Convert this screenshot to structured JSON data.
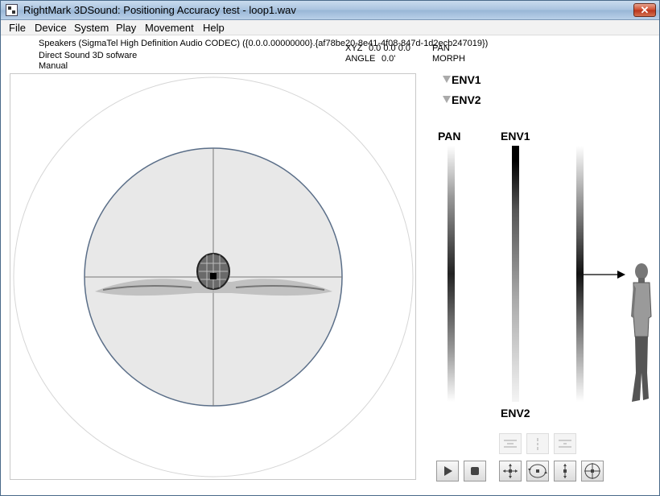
{
  "window": {
    "title": "RightMark 3DSound: Positioning Accuracy test - loop1.wav",
    "close_glyph": "✕"
  },
  "menu": [
    "File",
    "Device",
    "System",
    "Play",
    "Movement",
    "Help"
  ],
  "info": {
    "device": "Speakers (SigmaTel High Definition Audio CODEC) ({0.0.0.00000000}.{af78be20-8e41-4f08-847d-1d2ecb247019})",
    "engine": "Direct Sound 3D sofware",
    "mode": "Manual",
    "xyz_label": "XYZ",
    "xyz_value": "0.0 0.0 0.0",
    "angle_label": "ANGLE",
    "angle_value": "0.0'",
    "pan_label": "PAN",
    "morph_label": "MORPH"
  },
  "env": {
    "env1": "ENV1",
    "env2": "ENV2"
  },
  "meters": {
    "pan": "PAN",
    "env1": "ENV1",
    "env2": "ENV2"
  },
  "colors": {
    "field": "#e8e8e8",
    "frame": "#5a6e88",
    "accent": "#000000"
  },
  "toolbar": {
    "row1": [
      "align-horizontal-icon",
      "align-vertical-icon",
      "align-both-icon"
    ],
    "row2": [
      "play-icon",
      "stop-icon",
      "move-xy-icon",
      "rotate-icon",
      "move-y-icon",
      "orbit-icon"
    ]
  }
}
